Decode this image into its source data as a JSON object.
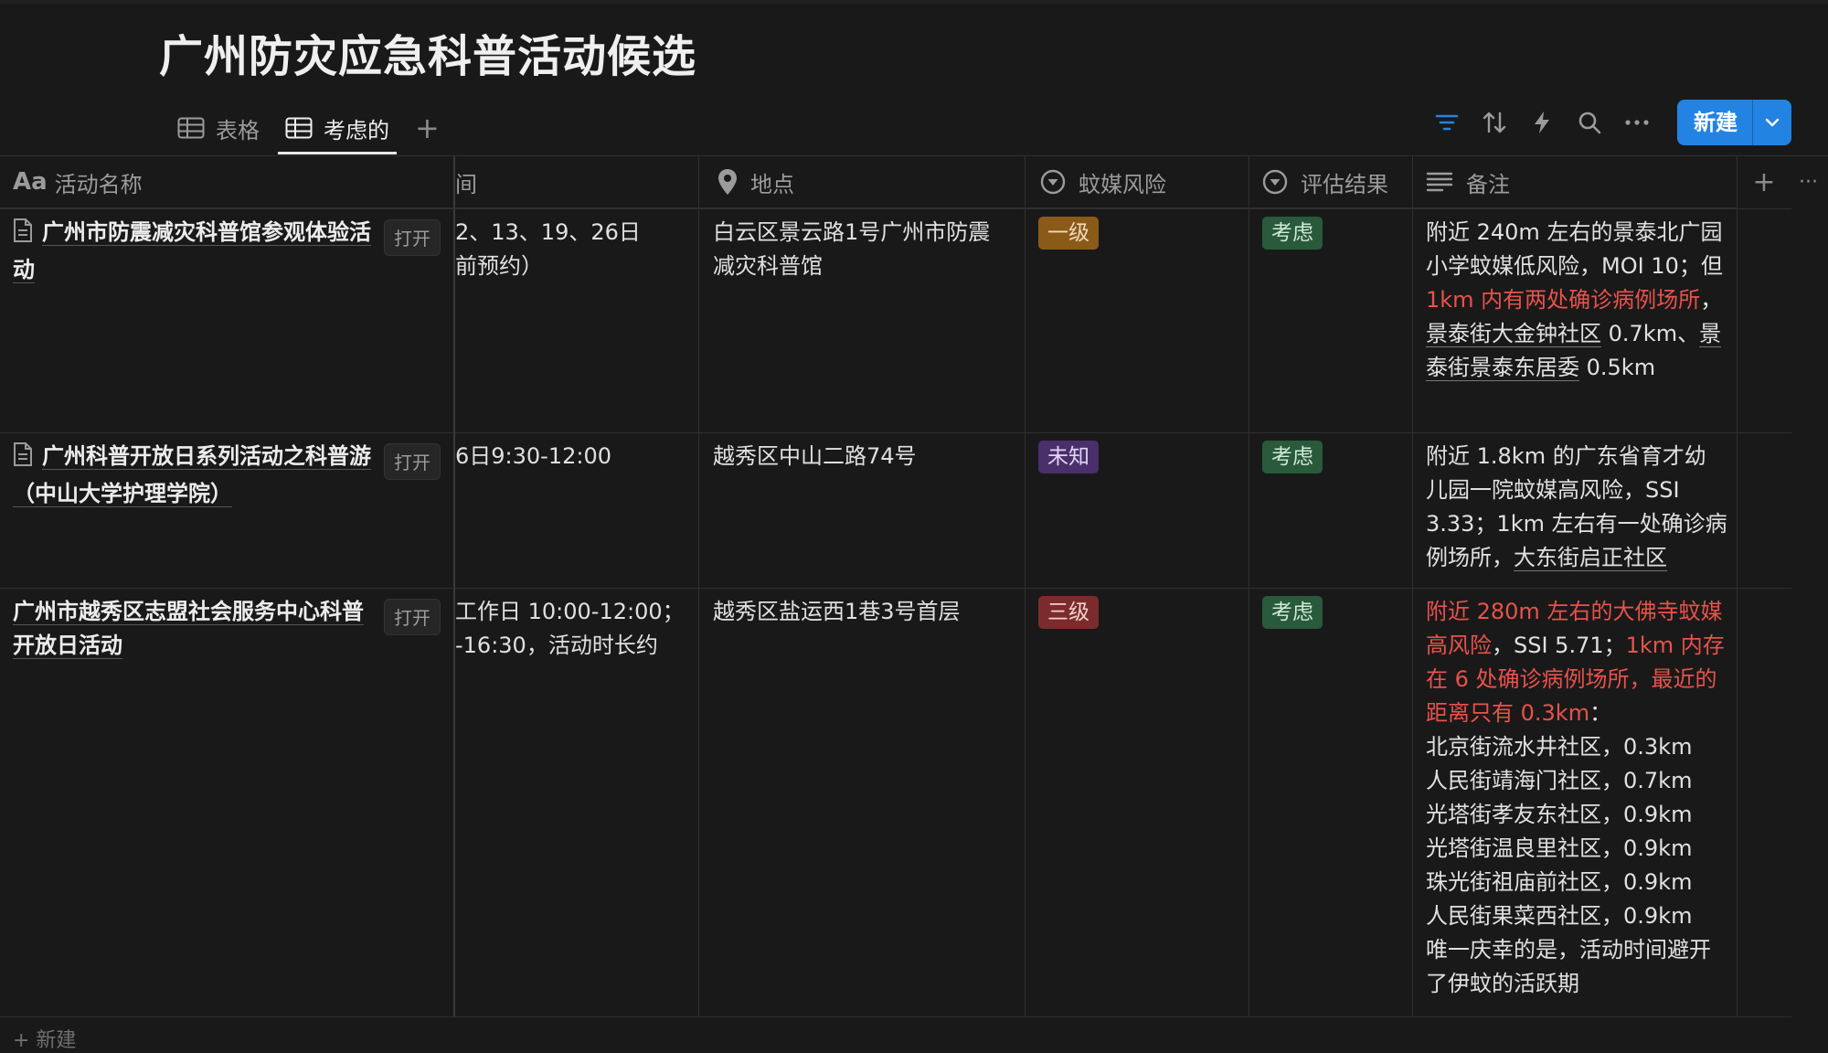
{
  "title": "广州防灾应急科普活动候选",
  "tabs": [
    {
      "label": "表格",
      "icon": "table-icon",
      "active": false
    },
    {
      "label": "考虑的",
      "icon": "table-icon",
      "active": true
    }
  ],
  "tab_add_label": "+",
  "toolbar": {
    "new_label": "新建",
    "icons": [
      "filter-icon",
      "sort-icon",
      "automation-icon",
      "search-icon",
      "more-icon"
    ],
    "accent": "#2383e2"
  },
  "columns": {
    "name": "活动名称",
    "name_prefix": "Aa",
    "time": "间",
    "location": "地点",
    "risk": "蚊媒风险",
    "result": "评估结果",
    "notes": "备注"
  },
  "add_column": "+",
  "more_columns": "···",
  "open_label": "打开",
  "rows": [
    {
      "name": "广州市防震减灾科普馆参观体验活动",
      "time": [
        "2、13、19、26日",
        "前预约）"
      ],
      "location": "白云区景云路1号广州市防震减灾科普馆",
      "risk": "一级",
      "result": "考虑",
      "notes": [
        {
          "t": "附近 240m 左右的景泰北广园小学蚊媒低风险，MOI 10；但 "
        },
        {
          "t": "1km 内有两处确诊病例场所",
          "c": "red"
        },
        {
          "t": "，"
        },
        {
          "t": "景泰街大金钟社区",
          "c": "ul"
        },
        {
          "t": " 0.7km、"
        },
        {
          "t": "景泰街景泰东居委",
          "c": "ul"
        },
        {
          "t": " 0.5km"
        }
      ]
    },
    {
      "name": "广州科普开放日系列活动之科普游（中山大学护理学院）",
      "time": [
        "6日9:30-12:00"
      ],
      "location": "越秀区中山二路74号",
      "risk": "未知",
      "result": "考虑",
      "notes": [
        {
          "t": "附近 1.8km 的广东省育才幼儿园一院蚊媒高风险，SSI 3.33；1km 左右有一处确诊病例场所，"
        },
        {
          "t": "大东街启正社区",
          "c": "ul"
        }
      ]
    },
    {
      "name": "广州市越秀区志盟社会服务中心科普开放日活动",
      "time": [
        "工作日 10:00-12:00；",
        "-16:30，活动时长约"
      ],
      "location": "越秀区盐运西1巷3号首层",
      "risk": "三级",
      "result": "考虑",
      "notes": [
        {
          "t": "附近 280m 左右的大佛寺蚊媒高风险",
          "c": "red"
        },
        {
          "t": "，SSI 5.71；"
        },
        {
          "t": "1km 内存在 6 处确诊病例场所，最近的距离只有 0.3km",
          "c": "red"
        },
        {
          "t": "：",
          "br": true
        },
        {
          "t": "北京街流水井社区，0.3km",
          "br": true
        },
        {
          "t": "人民街靖海门社区，0.7km",
          "br": true
        },
        {
          "t": "光塔街孝友东社区，0.9km",
          "br": true
        },
        {
          "t": "光塔街温良里社区，0.9km",
          "br": true
        },
        {
          "t": "珠光街祖庙前社区，0.9km",
          "br": true
        },
        {
          "t": "人民街果菜西社区，0.9km",
          "br": true
        },
        {
          "t": "唯一庆幸的是，活动时间避开了伊蚊的活跃期"
        }
      ]
    }
  ],
  "new_row_label": "+ 新建"
}
